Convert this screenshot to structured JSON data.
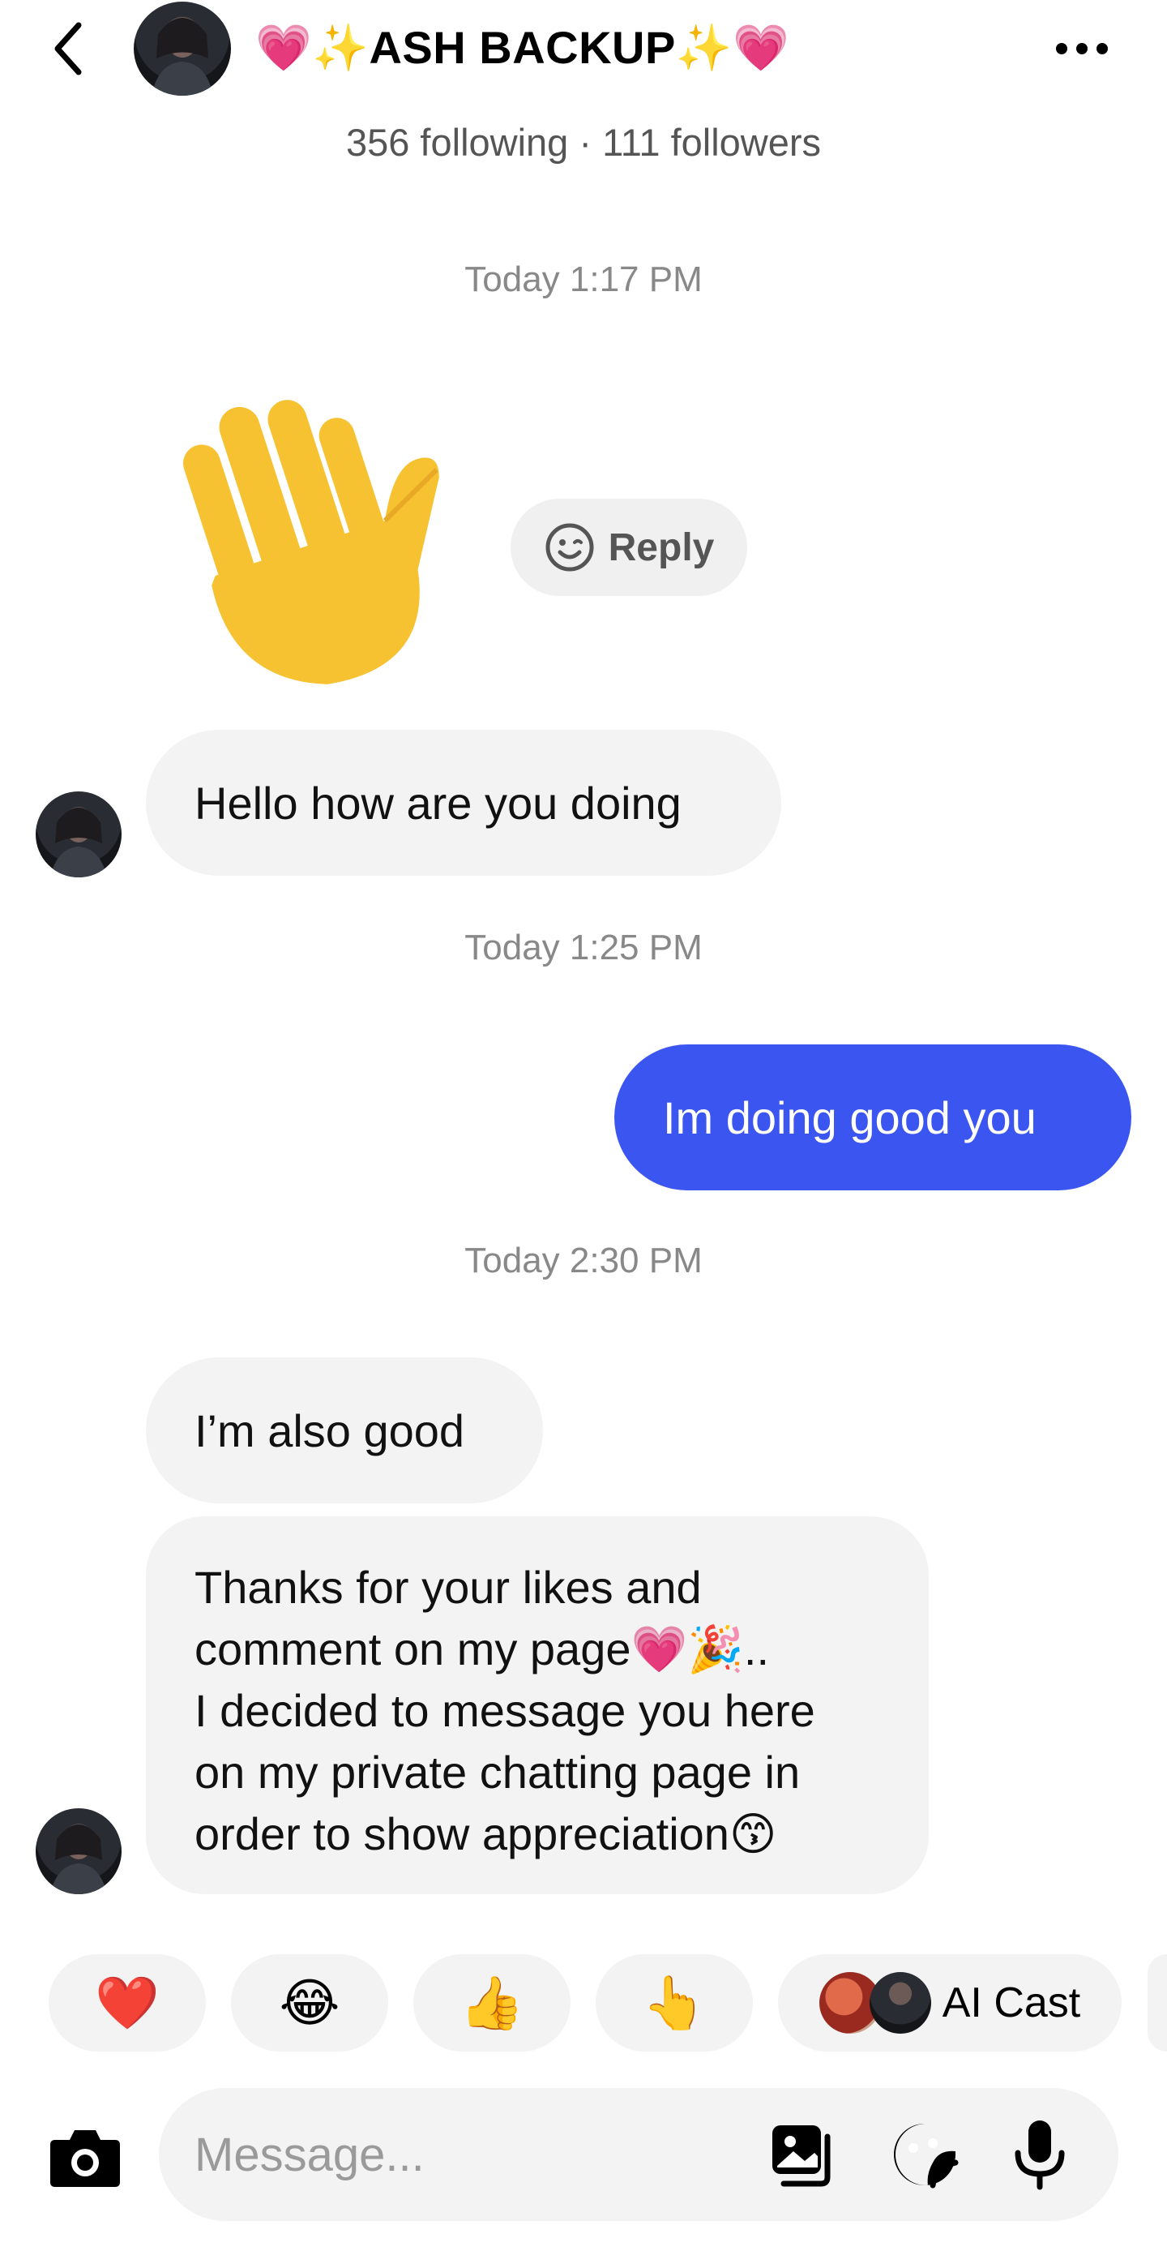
{
  "header": {
    "title": "💗✨ASH BACKUP✨💗",
    "follow_info": "356 following · 111 followers"
  },
  "timestamps": [
    "Today 1:17 PM",
    "Today 1:25 PM",
    "Today 2:30 PM"
  ],
  "reply_button": {
    "label": "Reply",
    "icon": "smile-icon"
  },
  "wave_emoji": "👋",
  "messages": [
    {
      "sender": "them",
      "text": "Hello how are you doing"
    },
    {
      "sender": "me",
      "text": "Im doing good you"
    },
    {
      "sender": "them",
      "text": "I’m also good"
    },
    {
      "sender": "them",
      "lines": [
        "Thanks for your likes and",
        "comment on my  page💗🎉..",
        "I decided to message you here",
        "on my private chatting page in",
        "order to show appreciation😙"
      ]
    }
  ],
  "quick_replies": [
    "❤️",
    "😂",
    "👍",
    "👆"
  ],
  "ai_cast": {
    "label": "AI Cast"
  },
  "composer": {
    "placeholder": "Message..."
  },
  "colors": {
    "accent": "#3b55f1",
    "bubble": "#f3f3f3",
    "timestamp": "#888888"
  }
}
